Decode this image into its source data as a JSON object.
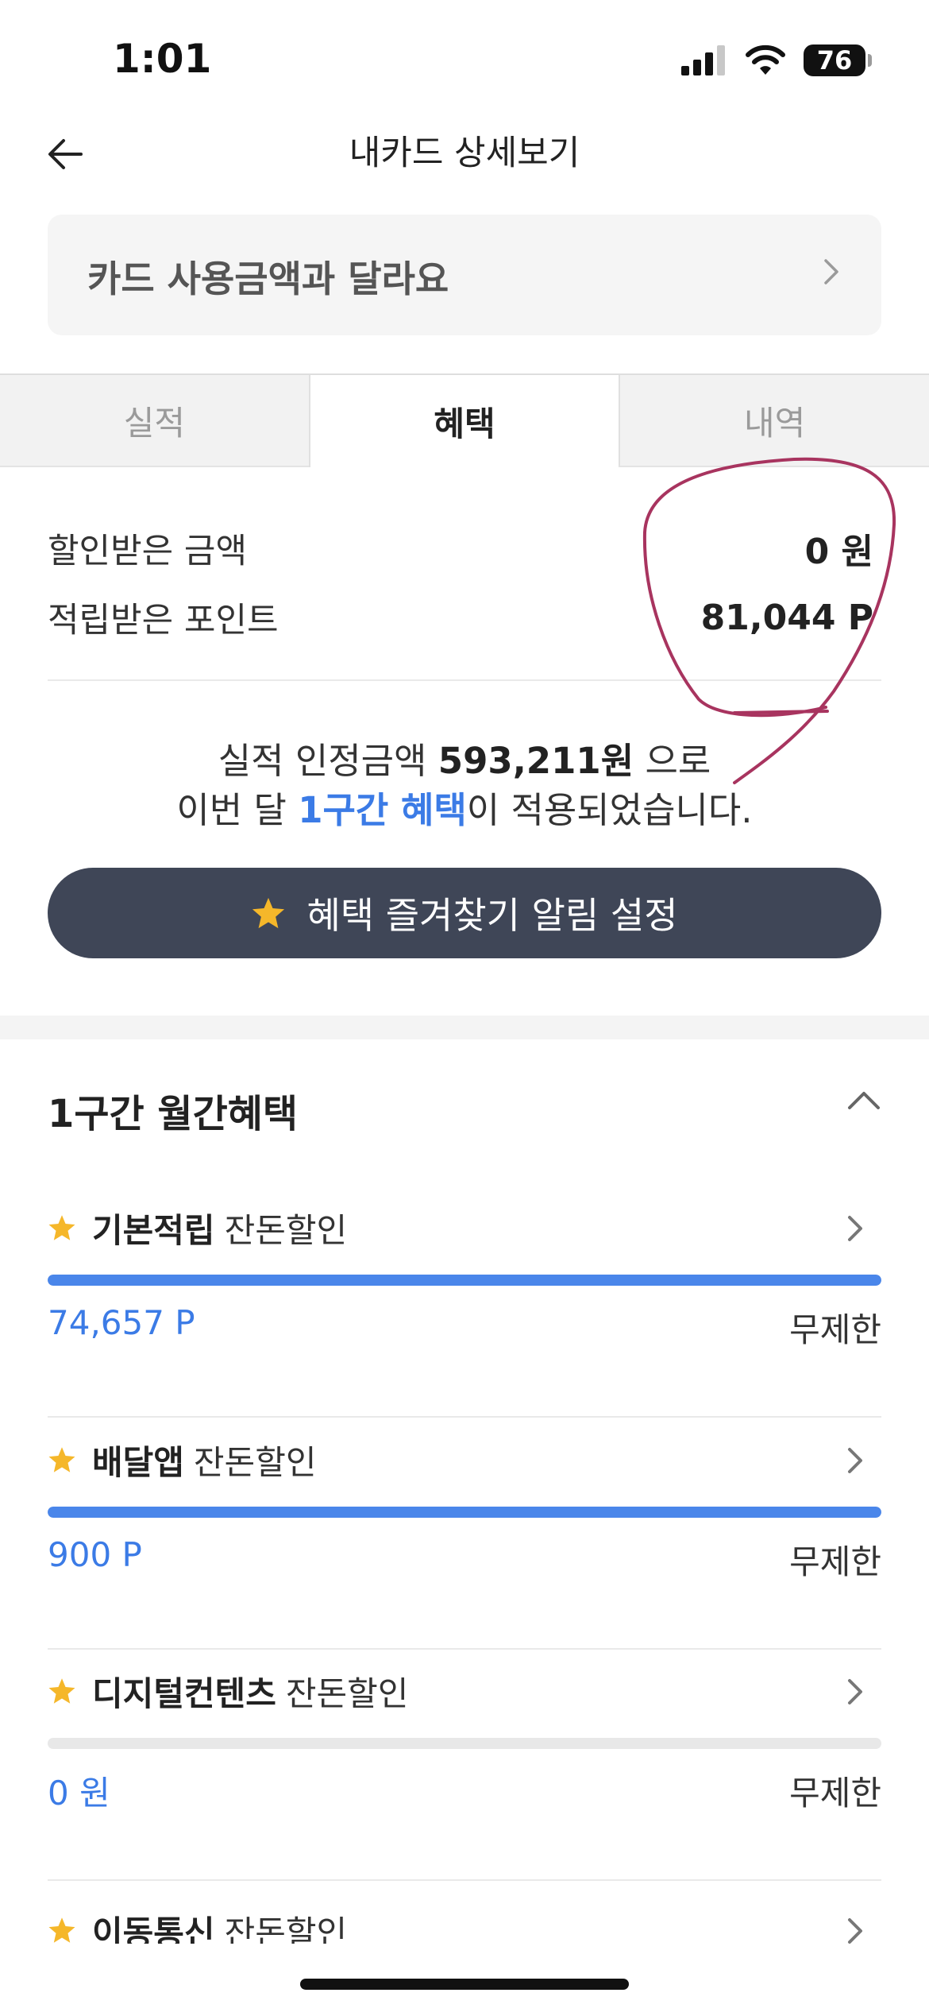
{
  "status_bar": {
    "time": "1:01",
    "battery": "76"
  },
  "header": {
    "title": "내카드 상세보기"
  },
  "notice": {
    "label": "카드 사용금액과 달라요"
  },
  "tabs": [
    {
      "label": "실적",
      "active": false
    },
    {
      "label": "혜택",
      "active": true
    },
    {
      "label": "내역",
      "active": false
    }
  ],
  "summary": {
    "discount_label": "할인받은 금액",
    "discount_value": "0 원",
    "points_label": "적립받은 포인트",
    "points_value": "81,044 P"
  },
  "result": {
    "line1_pre": "실적 인정금액 ",
    "line1_amount": "593,211원",
    "line1_post": " 으로",
    "line2_pre": "이번 달 ",
    "line2_tier": "1구간 혜택",
    "line2_post": "이 적용되었습니다."
  },
  "favorite_button": {
    "label": "혜택 즐겨찾기 알림 설정"
  },
  "section": {
    "title": "1구간 월간혜택"
  },
  "benefits": [
    {
      "name": "기본적립",
      "type": "잔돈할인",
      "amount": "74,657 P",
      "limit": "무제한",
      "progress": 1.0
    },
    {
      "name": "배달앱",
      "type": "잔돈할인",
      "amount": "900 P",
      "limit": "무제한",
      "progress": 1.0
    },
    {
      "name": "디지털컨텐츠",
      "type": "잔돈할인",
      "amount": "0 원",
      "limit": "무제한",
      "progress": 0.0
    },
    {
      "name": "이동통신",
      "type": "잔돈할인"
    }
  ],
  "colors": {
    "accent_blue": "#3b7be6",
    "button_dark": "#3f4657",
    "star": "#f5b72a",
    "annotation": "#a8345f"
  },
  "icons": [
    "back-arrow-icon",
    "chevron-right-icon",
    "chevron-up-icon",
    "star-icon",
    "signal-icon",
    "wifi-icon",
    "battery-icon"
  ]
}
